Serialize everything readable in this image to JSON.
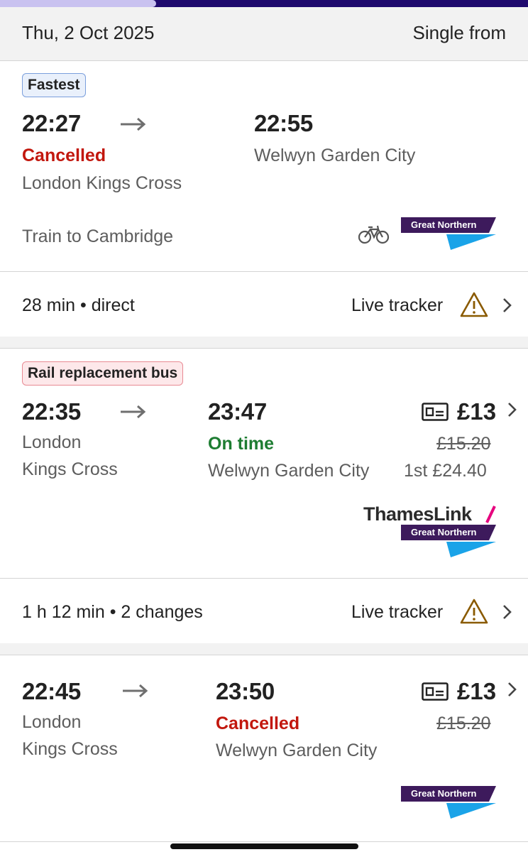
{
  "header": {
    "date": "Thu, 2 Oct 2025",
    "fare_type": "Single from",
    "colors": {
      "progress_track": "#1f0a6e",
      "progress_fill": "#c9c2f0"
    }
  },
  "journeys": [
    {
      "tag": "Fastest",
      "depart_time": "22:27",
      "depart_status": "Cancelled",
      "depart_station": "London Kings Cross",
      "arrive_time": "22:55",
      "arrive_station": "Welwyn Garden City",
      "service": "Train to Cambridge",
      "operator_logo": "Great Northern",
      "icons": [
        "bicycle-icon",
        "great-northern-logo"
      ],
      "duration": "28 min",
      "changes": "direct",
      "live_tracker": "Live tracker"
    },
    {
      "tag": "Rail replacement bus",
      "depart_time": "22:35",
      "depart_station_line1": "London",
      "depart_station_line2": "Kings Cross",
      "arrive_time": "23:47",
      "arrive_status": "On time",
      "arrive_station": "Welwyn Garden City",
      "price": "£13",
      "old_price": "£15.20",
      "first_class": "1st £24.40",
      "operator_logo_top": "ThamesLink",
      "operator_logo_bottom": "Great Northern",
      "duration": "1 h 12 min",
      "changes": "2 changes",
      "live_tracker": "Live tracker"
    },
    {
      "depart_time": "22:45",
      "depart_station_line1": "London",
      "depart_station_line2": "Kings Cross",
      "arrive_time": "23:50",
      "arrive_status": "Cancelled",
      "arrive_station": "Welwyn Garden City",
      "price": "£13",
      "old_price": "£15.20",
      "operator_logo": "Great Northern"
    }
  ],
  "colors": {
    "cancelled": "#c2170d",
    "on_time": "#1e7d32",
    "great_northern_purple": "#3d1a5c",
    "great_northern_blue": "#1aa3e8",
    "thameslink_pink": "#e6007e",
    "warning": "#8a5a00"
  }
}
